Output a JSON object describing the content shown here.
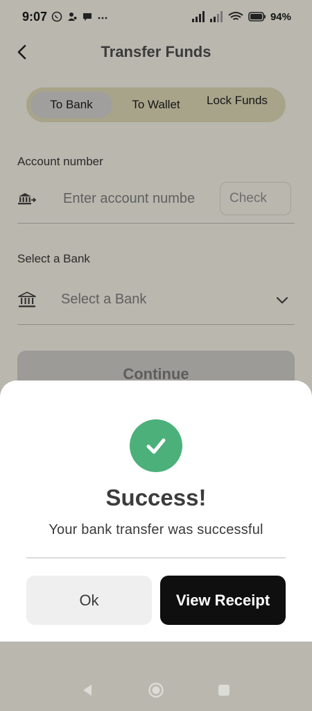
{
  "status_bar": {
    "time": "9:07",
    "battery": "94%",
    "icons": [
      "whatsapp-icon",
      "person-icon",
      "chat-icon",
      "more-icon",
      "signal-icon",
      "signal-icon",
      "wifi-icon",
      "battery-icon"
    ]
  },
  "header": {
    "title": "Transfer Funds",
    "back_icon": "back-arrow-icon"
  },
  "tabs": [
    {
      "label": "To Bank",
      "active": true
    },
    {
      "label": "To Wallet",
      "active": false
    },
    {
      "label": "Lock Funds",
      "active": false
    }
  ],
  "form": {
    "account_label": "Account number",
    "account_placeholder": "Enter account numbe",
    "account_value": "",
    "check_label": "Check",
    "bank_label": "Select a Bank",
    "bank_placeholder": "Select a Bank",
    "continue_label": "Continue"
  },
  "dialog": {
    "title": "Success!",
    "message": "Your bank transfer was successful",
    "ok_label": "Ok",
    "receipt_label": "View Receipt"
  },
  "colors": {
    "success_green": "#4cb07a",
    "receipt_button": "#0f0f0f",
    "overlay_background": "#b9b7ae"
  }
}
